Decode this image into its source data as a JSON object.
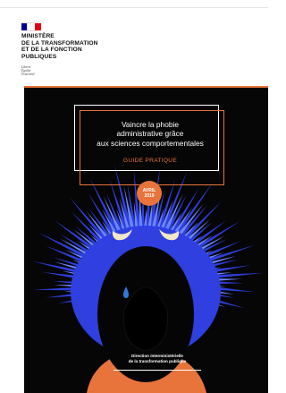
{
  "header": {
    "flag_colors": [
      "#000091",
      "#ffffff",
      "#e1000f"
    ],
    "ministry_lines": [
      "MINISTÈRE",
      "DE LA TRANSFORMATION",
      "ET DE LA FONCTION",
      "PUBLIQUES"
    ],
    "motto_lines": [
      "Liberté",
      "Égalité",
      "Fraternité"
    ]
  },
  "cover": {
    "title_lines": [
      "Vaincre la phobie",
      "administrative grâce",
      "aux sciences comportementales"
    ],
    "subtitle": "GUIDE PRATIQUE",
    "date_lines": [
      "AVRIL",
      "2019"
    ],
    "footer_lines": [
      "Direction interministérielle",
      "de la transformation publique"
    ],
    "colors": {
      "background": "#060606",
      "accent": "#e8743b",
      "hair": "#2f3fe0",
      "hair_light": "#6a86ff",
      "eyes": "#f2e7c6",
      "tear": "#2e7ad9",
      "body": "#e8743b"
    }
  }
}
